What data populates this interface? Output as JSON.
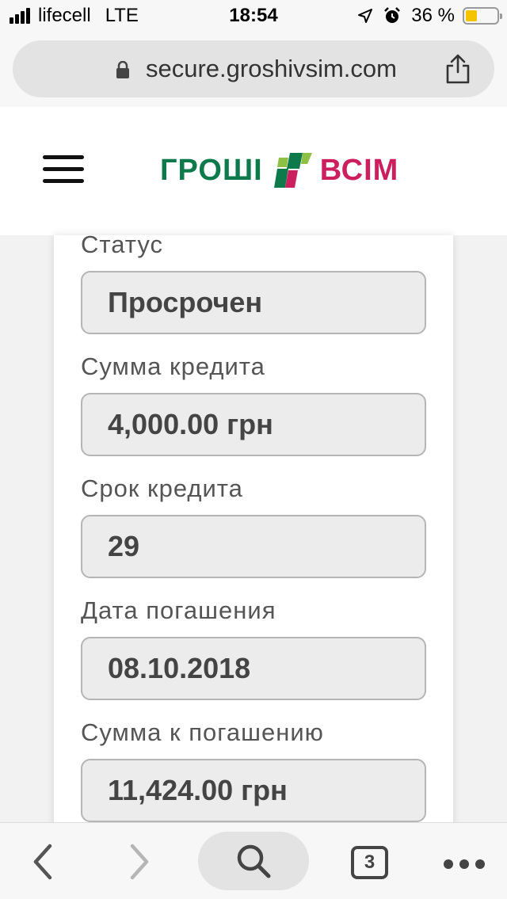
{
  "status_bar": {
    "carrier": "lifecell",
    "network": "LTE",
    "time": "18:54",
    "battery_percent": "36 %",
    "battery_level": 0.36
  },
  "browser": {
    "url": "secure.groshivsim.com",
    "tab_count": "3"
  },
  "logo": {
    "word1": "ГРОШІ",
    "word2": "ВСІМ",
    "color_green": "#0e7a4c",
    "color_pink": "#cc1f5f"
  },
  "fields": [
    {
      "label": "Статус",
      "value": "Просрочен"
    },
    {
      "label": "Сумма кредита",
      "value": "4,000.00 грн"
    },
    {
      "label": "Срок кредита",
      "value": "29"
    },
    {
      "label": "Дата погашения",
      "value": "08.10.2018"
    },
    {
      "label": "Сумма к погашению",
      "value": "11,424.00 грн"
    }
  ]
}
